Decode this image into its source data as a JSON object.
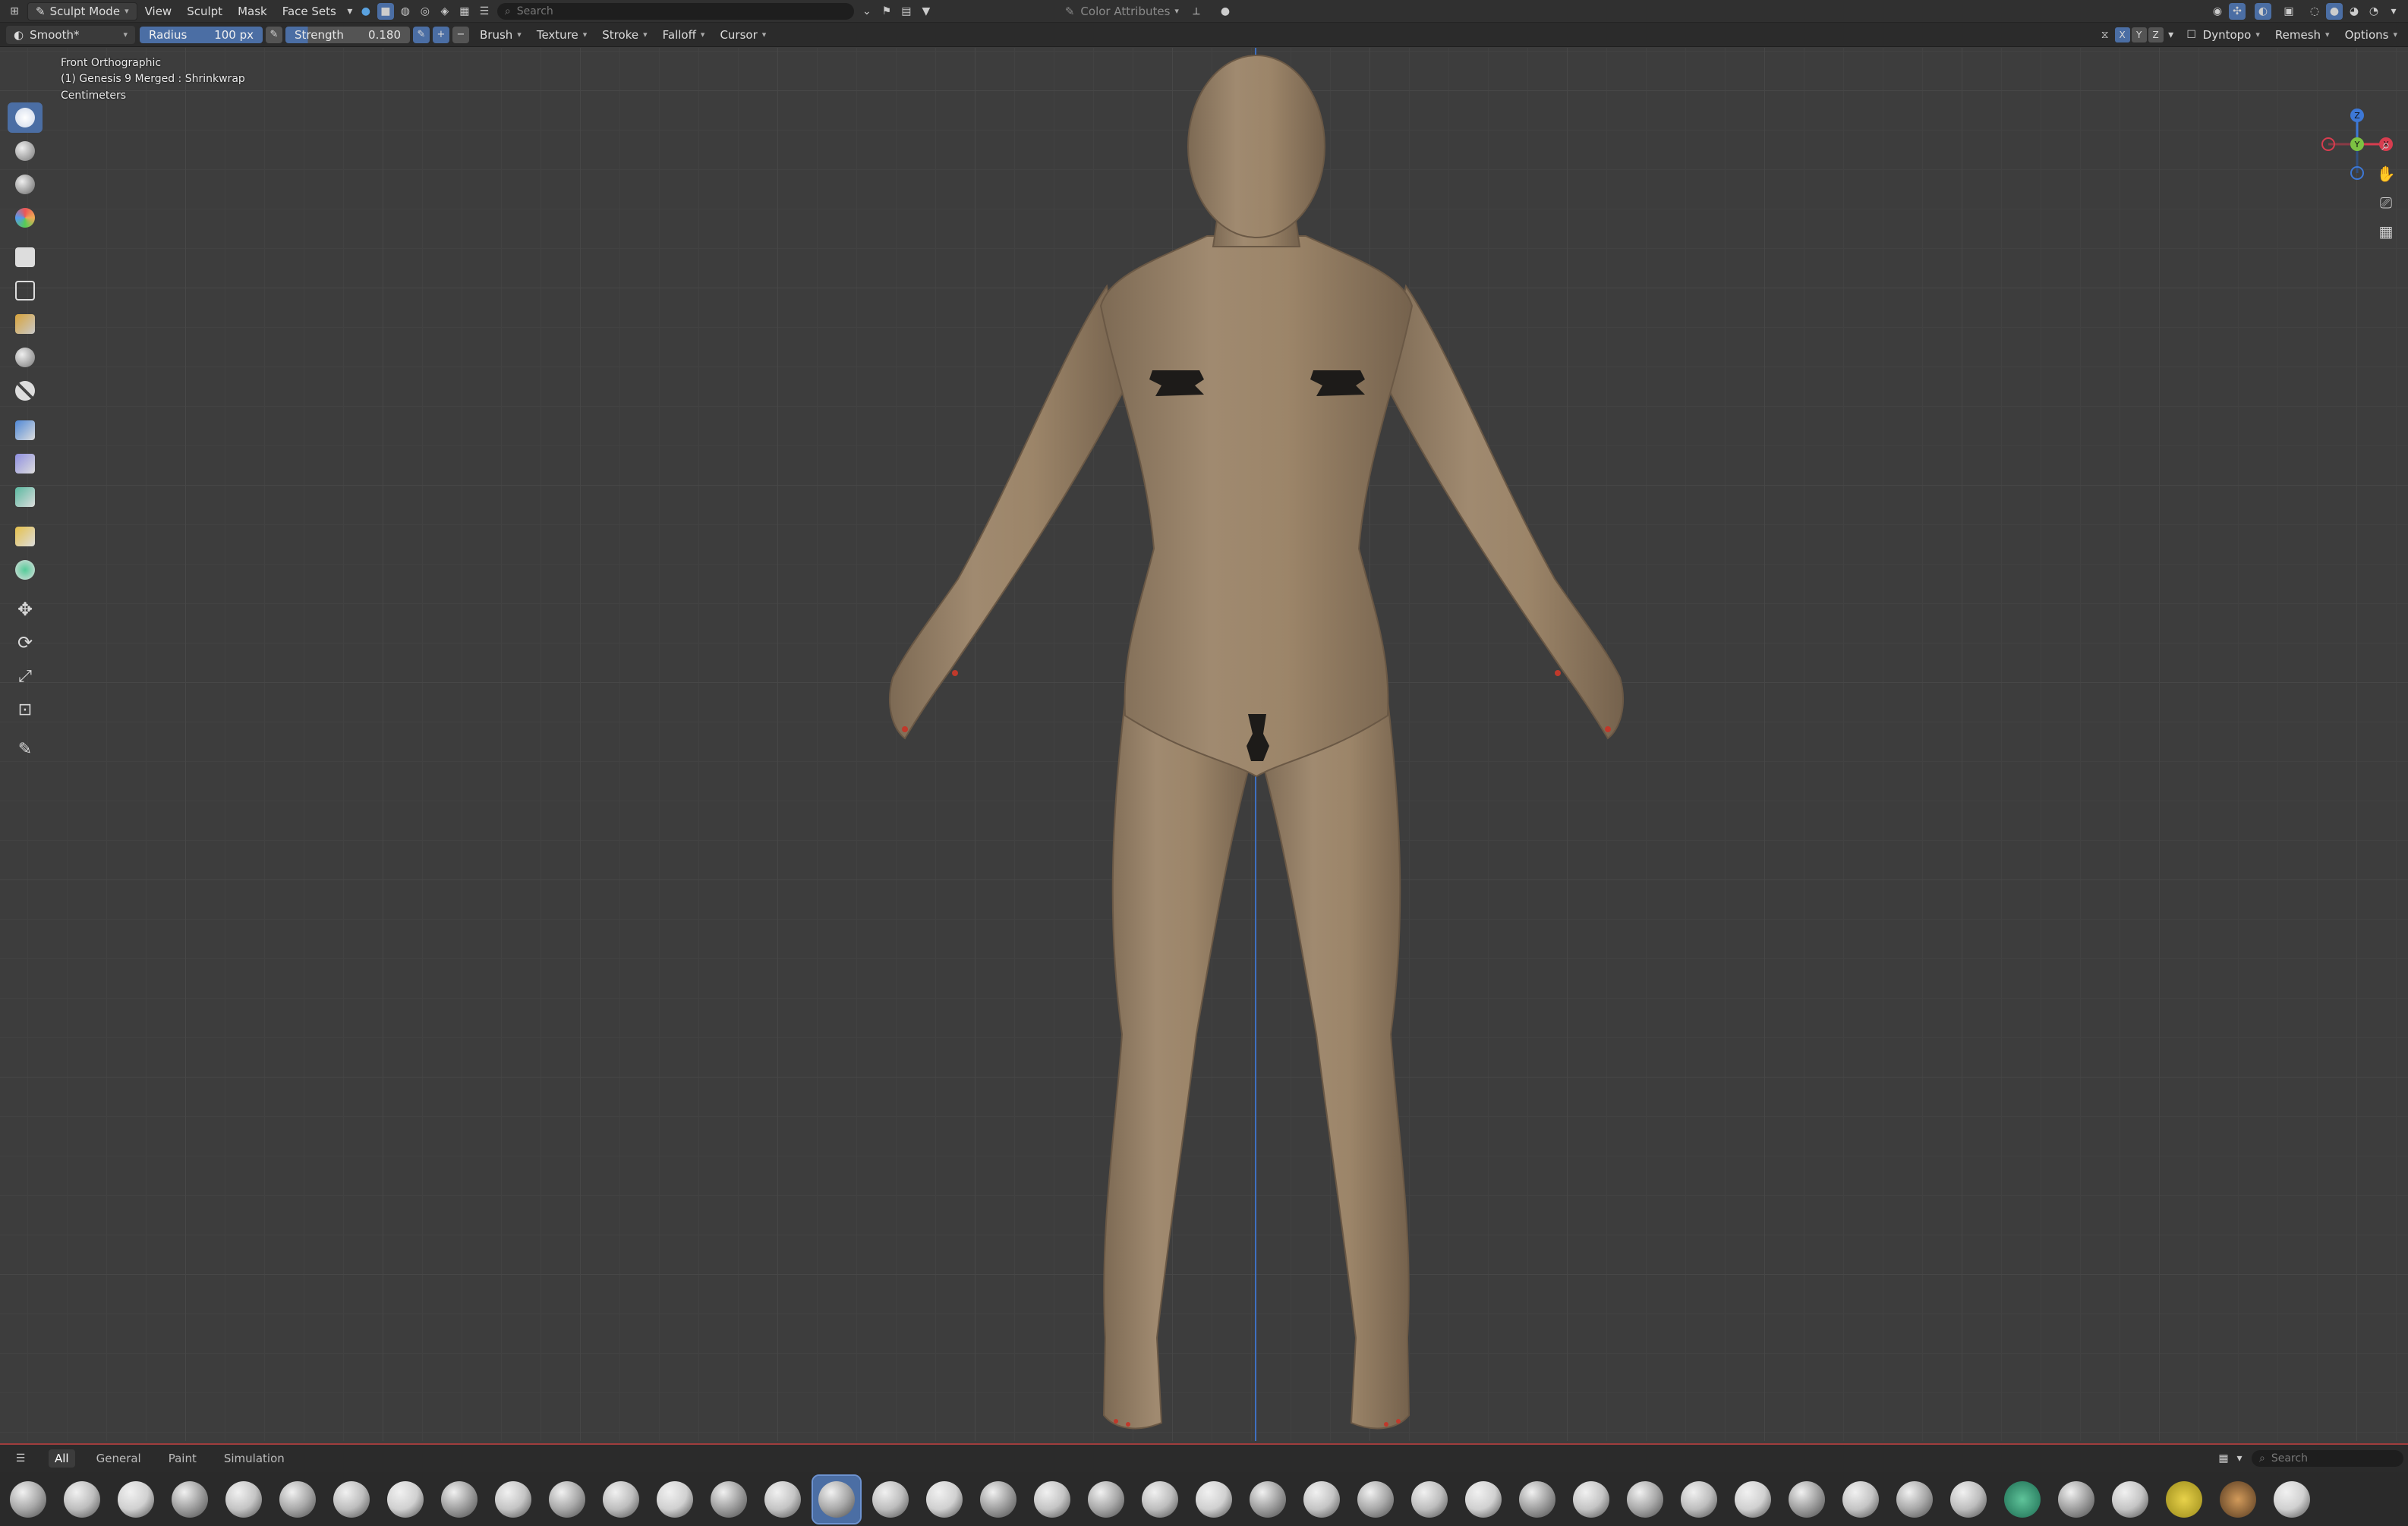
{
  "header": {
    "mode": "Sculpt Mode",
    "menus": [
      "View",
      "Sculpt",
      "Mask",
      "Face Sets"
    ],
    "search_placeholder": "Search",
    "color_attributes": "Color Attributes"
  },
  "tool_settings": {
    "brush_name": "Smooth*",
    "radius_label": "Radius",
    "radius_value": "100 px",
    "strength_label": "Strength",
    "strength_value": "0.180",
    "plus": "+",
    "minus": "−",
    "menus": [
      "Brush",
      "Texture",
      "Stroke",
      "Falloff",
      "Cursor"
    ],
    "axes": [
      "X",
      "Y",
      "Z"
    ],
    "dyntopo": "Dyntopo",
    "remesh": "Remesh",
    "options": "Options"
  },
  "viewport": {
    "view_name": "Front Orthographic",
    "object_line": "(1) Genesis 9  Merged : Shrinkwrap",
    "units": "Centimeters",
    "gizmo": {
      "x": "X",
      "y": "Y",
      "z": "Z"
    }
  },
  "left_toolbar": {
    "tools": [
      {
        "icon": "draw-brush-icon",
        "active": true
      },
      {
        "icon": "paint-brush-icon"
      },
      {
        "icon": "smear-brush-icon"
      },
      {
        "icon": "color-paint-icon"
      },
      {
        "icon": "mask-box-icon"
      },
      {
        "icon": "mask-lasso-icon"
      },
      {
        "icon": "face-set-icon"
      },
      {
        "icon": "trim-icon"
      },
      {
        "icon": "line-project-icon"
      },
      {
        "icon": "mesh-filter-icon"
      },
      {
        "icon": "cloth-filter-icon"
      },
      {
        "icon": "color-filter-icon"
      },
      {
        "icon": "edit-face-set-icon"
      },
      {
        "icon": "mask-by-color-icon"
      },
      {
        "icon": "move-icon"
      },
      {
        "icon": "rotate-icon"
      },
      {
        "icon": "scale-icon"
      },
      {
        "icon": "transform-icon"
      },
      {
        "icon": "annotate-icon"
      }
    ]
  },
  "footer": {
    "tabs": [
      "All",
      "General",
      "Paint",
      "Simulation"
    ],
    "search_placeholder": "Search",
    "brush_count": 43,
    "active_brush_index": 15
  },
  "colors": {
    "accent": "#4b6ea4",
    "skin": "#9a8469",
    "background": "#3d3d3d",
    "z_axis": "#3f6fbf"
  }
}
